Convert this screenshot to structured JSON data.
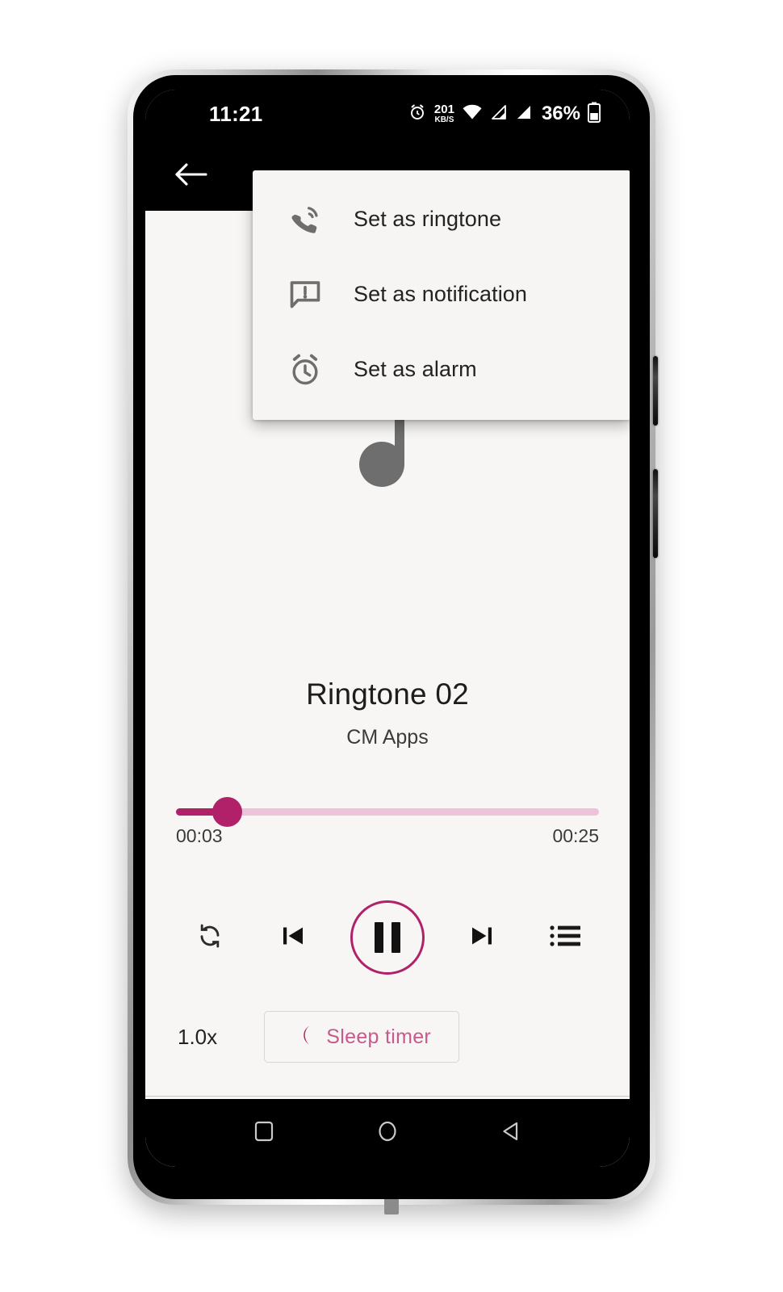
{
  "status_bar": {
    "time": "11:21",
    "net_speed_value": "201",
    "net_speed_unit": "KB/S",
    "battery_percent": "36%",
    "icons": [
      "alarm-icon",
      "wifi-icon",
      "signal-icon-1",
      "signal-icon-2",
      "battery-icon"
    ]
  },
  "toolbar": {
    "back_icon": "back-arrow-icon"
  },
  "popup_menu": {
    "items": [
      {
        "label": "Set as ringtone",
        "icon": "ring-volume-icon"
      },
      {
        "label": "Set as notification",
        "icon": "notification-bubble-icon"
      },
      {
        "label": "Set as alarm",
        "icon": "alarm-clock-icon"
      }
    ]
  },
  "artwork": {
    "placeholder_icon": "music-note-icon"
  },
  "track": {
    "title": "Ringtone 02",
    "artist": "CM Apps"
  },
  "seek": {
    "current_time": "00:03",
    "total_time": "00:25",
    "progress_percent": 12
  },
  "controls": {
    "repeat": "repeat-icon",
    "previous": "previous-track-icon",
    "play_pause": "pause-icon",
    "next": "next-track-icon",
    "queue": "playlist-queue-icon"
  },
  "bottom": {
    "speed_label": "1.0x",
    "sleep_timer_label": "Sleep timer",
    "sleep_timer_icon": "crescent-moon-icon"
  },
  "nav_bar": {
    "recents": "square-recents-icon",
    "home": "circle-home-icon",
    "back": "triangle-back-icon"
  },
  "colors": {
    "accent": "#b1216a",
    "accent_light": "#eec2d7",
    "sleep_text": "#c7598d",
    "screen_bg": "#f7f6f4",
    "system_bar": "#000000",
    "menu_bg": "#f6f5f3",
    "icon_gray": "#6e6e6e"
  }
}
